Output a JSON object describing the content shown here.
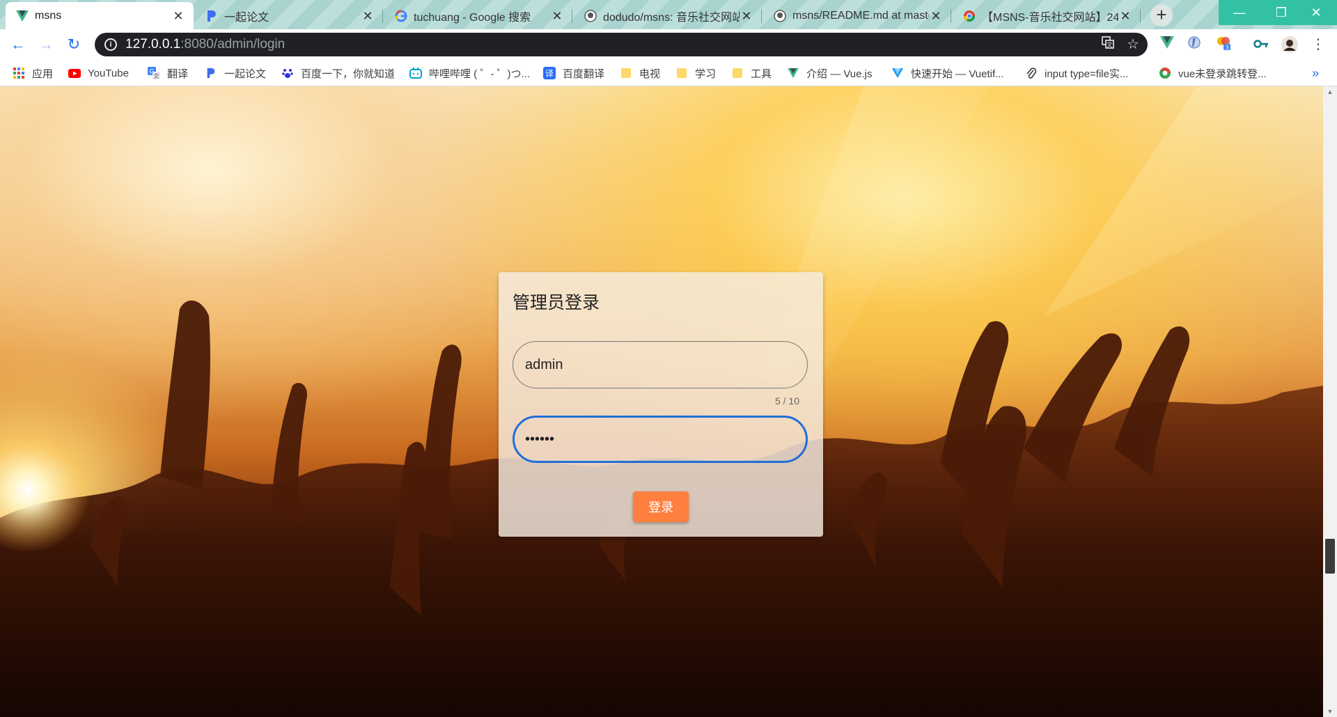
{
  "browser": {
    "tabs": [
      {
        "title": "msns",
        "icon": "vue-icon",
        "active": true
      },
      {
        "title": "一起论文",
        "icon": "p-icon",
        "active": false
      },
      {
        "title": "tuchuang - Google 搜索",
        "icon": "google-icon",
        "active": false
      },
      {
        "title": "dodudo/msns: 音乐社交网站",
        "icon": "github-icon",
        "active": false
      },
      {
        "title": "msns/README.md at master",
        "icon": "github-icon",
        "active": false
      },
      {
        "title": "【MSNS-音乐社交网站】24",
        "icon": "chrome-icon",
        "active": false
      }
    ],
    "new_tab": "+",
    "window_controls": {
      "minimize": "—",
      "restore": "❐",
      "close": "✕"
    },
    "url": {
      "host": "127.0.0.1",
      "path": ":8080/admin/login"
    },
    "bookmarks": [
      {
        "label": "应用",
        "icon": "apps-grid-icon"
      },
      {
        "label": "YouTube",
        "icon": "youtube-icon"
      },
      {
        "label": "翻译",
        "icon": "translate-icon"
      },
      {
        "label": "一起论文",
        "icon": "p-icon"
      },
      {
        "label": "百度一下，你就知道",
        "icon": "baidu-paw-icon"
      },
      {
        "label": "哔哩哔哩 ( ゜- ゜)つ...",
        "icon": "bilibili-icon"
      },
      {
        "label": "百度翻译",
        "icon": "baidu-translate-icon"
      },
      {
        "label": "电视",
        "icon": "folder-icon"
      },
      {
        "label": "学习",
        "icon": "folder-icon"
      },
      {
        "label": "工具",
        "icon": "folder-icon"
      },
      {
        "label": "介绍 — Vue.js",
        "icon": "vue-icon"
      },
      {
        "label": "快速开始 — Vuetif...",
        "icon": "vuetify-icon"
      },
      {
        "label": "input type=file实...",
        "icon": "paper-clip-icon"
      },
      {
        "label": "vue未登录跳转登...",
        "icon": "chrome-icon"
      }
    ],
    "more_bookmarks": "»",
    "extension_badge": "3"
  },
  "login": {
    "title": "管理员登录",
    "username_value": "admin",
    "username_counter": "5 / 10",
    "password_value": "123456",
    "submit_label": "登录"
  },
  "colors": {
    "accent_blue": "#1e6fd9",
    "button_orange": "#ff7f3f",
    "tab_strip": "#a9d3cf",
    "window_controls": "#33c1a3"
  }
}
